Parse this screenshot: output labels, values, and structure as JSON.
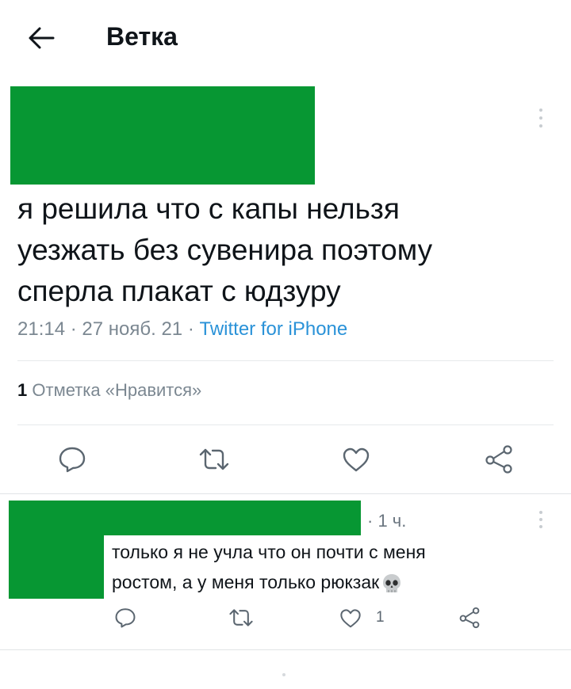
{
  "header": {
    "title": "Ветка",
    "back_icon": "arrow-left-icon"
  },
  "colors": {
    "redaction": "#079733",
    "accent_link": "#2a92d8",
    "muted": "#7b8791"
  },
  "main_tweet": {
    "text": "я решила что с капы нельзя уезжать без сувенира поэтому сперла плакат с юдзуру",
    "time": "21:14",
    "date": "27 нояб. 21",
    "source": "Twitter for iPhone",
    "likes_count": "1",
    "likes_label": "Отметка «Нравится»",
    "actions": [
      "reply-icon",
      "retweet-icon",
      "like-icon",
      "share-icon"
    ]
  },
  "reply": {
    "time": "1 ч.",
    "text_line1": "только я не учла что он почти с меня",
    "text_line2": "ростом, а у меня только рюкзак",
    "emoji": "skull-icon",
    "like_count": "1"
  }
}
